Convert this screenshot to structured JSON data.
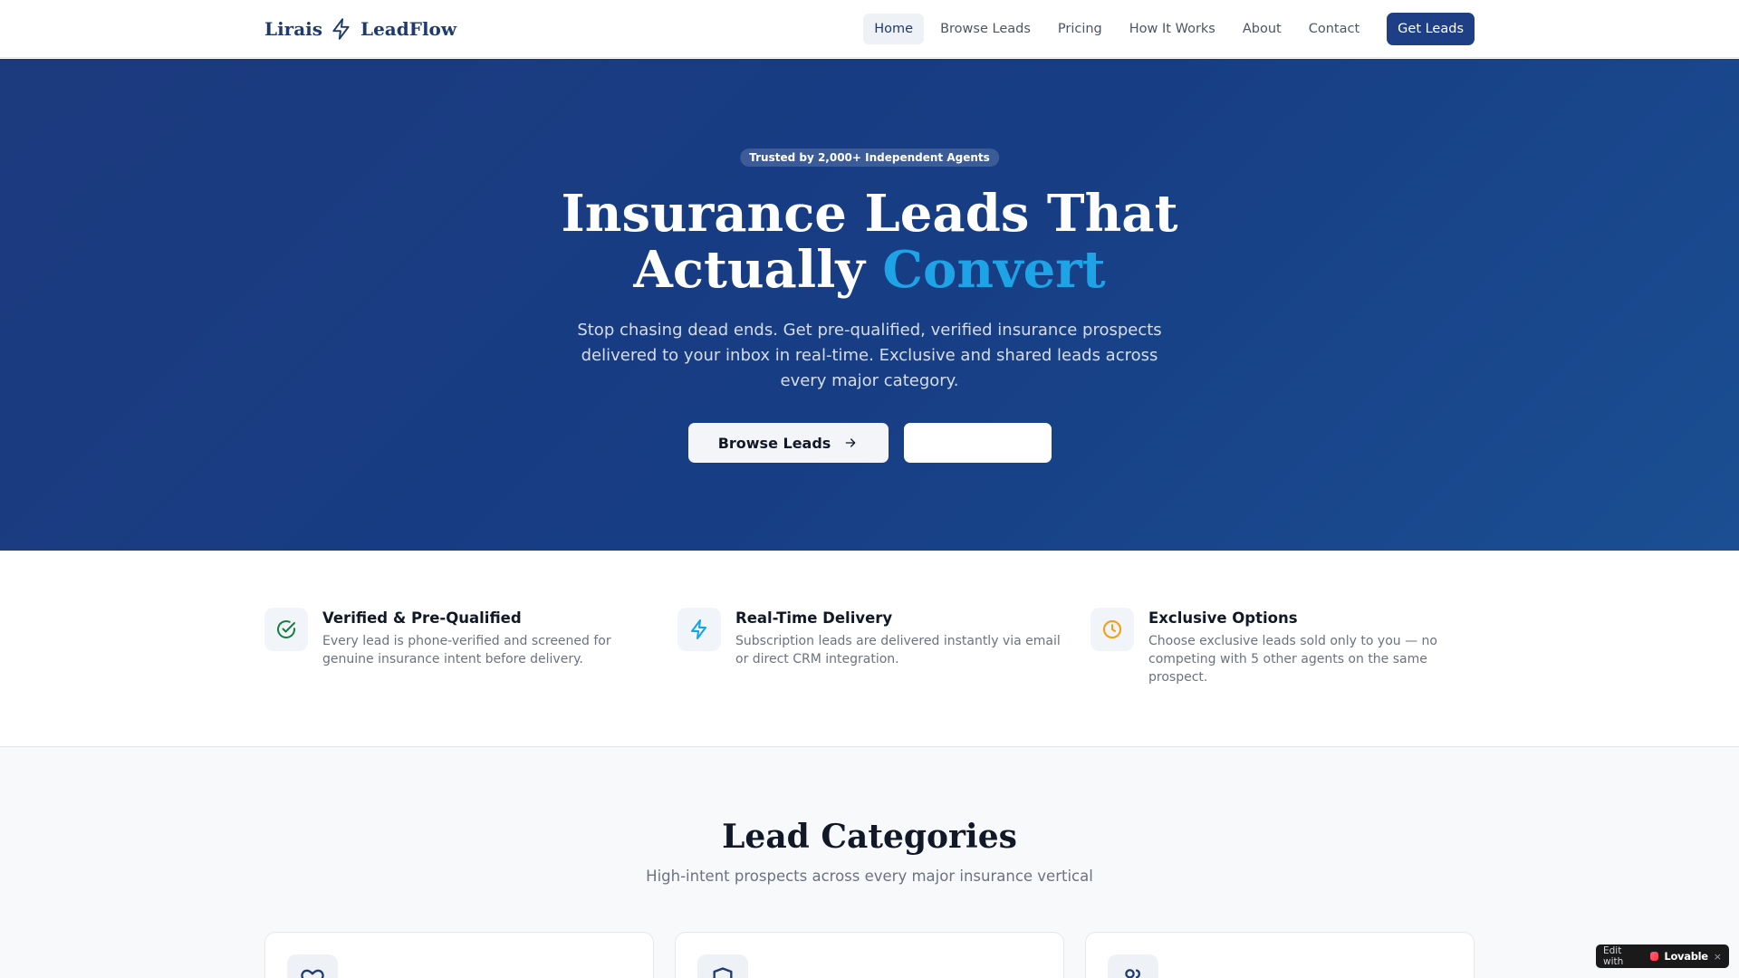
{
  "nav": {
    "brand_left": "Lirais",
    "brand_right": "LeadFlow",
    "links": [
      "Home",
      "Browse Leads",
      "Pricing",
      "How It Works",
      "About",
      "Contact"
    ],
    "cta": "Get Leads"
  },
  "hero": {
    "badge": "Trusted by 2,000+ Independent Agents",
    "title_line1": "Insurance Leads That",
    "title_line2_plain": "Actually",
    "title_line2_accent": "Convert",
    "subtitle": "Stop chasing dead ends. Get pre-qualified, verified insurance prospects delivered to your inbox in real-time. Exclusive and shared leads across every major category.",
    "primary_button": "Browse Leads",
    "secondary_button": ""
  },
  "features": [
    {
      "icon": "check-circle-icon",
      "title": "Verified & Pre-Qualified",
      "desc": "Every lead is phone-verified and screened for genuine insurance intent before delivery."
    },
    {
      "icon": "lightning-icon",
      "title": "Real-Time Delivery",
      "desc": "Subscription leads are delivered instantly via email or direct CRM integration."
    },
    {
      "icon": "clock-icon",
      "title": "Exclusive Options",
      "desc": "Choose exclusive leads sold only to you — no competing with 5 other agents on the same prospect."
    }
  ],
  "categories": {
    "title": "Lead Categories",
    "subtitle": "High-intent prospects across every major insurance vertical",
    "cards": [
      {
        "icon": "heart-icon"
      },
      {
        "icon": "shield-icon"
      },
      {
        "icon": "users-icon"
      }
    ]
  },
  "lovable": {
    "edit_label": "Edit with",
    "brand": "Lovable",
    "close": "×"
  },
  "colors": {
    "brand_navy": "#1e3a6e",
    "hero_bg": "#173d84",
    "accent_blue": "#1ea4e6",
    "check_green": "#15803d",
    "bolt_blue": "#0ea5e9",
    "clock_amber": "#f59e0b"
  }
}
